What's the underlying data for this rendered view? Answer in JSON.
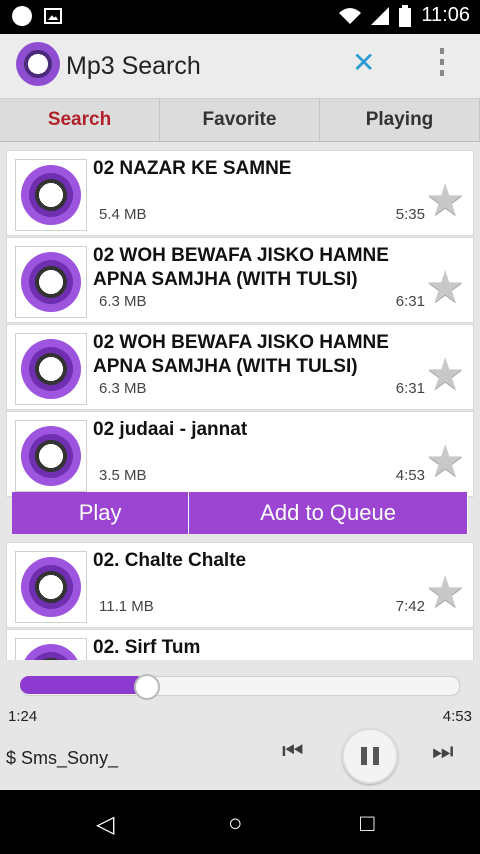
{
  "status": {
    "time": "11:06"
  },
  "appbar": {
    "title": "Mp3 Search",
    "close_symbol": "✕"
  },
  "tabs": [
    {
      "label": "Search",
      "active": true
    },
    {
      "label": "Favorite",
      "active": false
    },
    {
      "label": "Playing",
      "active": false
    }
  ],
  "songs": [
    {
      "name": "02 NAZAR KE SAMNE",
      "size": "5.4 MB",
      "duration": "5:35"
    },
    {
      "name": "02 WOH BEWAFA JISKO HAMNE APNA SAMJHA (WITH TULSI)",
      "size": "6.3 MB",
      "duration": "6:31"
    },
    {
      "name": "02 WOH BEWAFA JISKO HAMNE APNA SAMJHA (WITH TULSI)",
      "size": "6.3 MB",
      "duration": "6:31"
    },
    {
      "name": "02 judaai - jannat",
      "size": "3.5 MB",
      "duration": "4:53"
    },
    {
      "name": "02. Chalte Chalte",
      "size": "11.1 MB",
      "duration": "7:42"
    },
    {
      "name": "02. Sirf Tum",
      "size": "",
      "duration": ""
    }
  ],
  "actions": {
    "play": "Play",
    "queue": "Add to Queue"
  },
  "player": {
    "elapsed": "1:24",
    "total": "4:53",
    "artist": "Sms_Sony_",
    "artist_prefix": "$",
    "progress_fraction": 0.286
  },
  "icons": {
    "star": "★",
    "prev": "⏮",
    "next": "⏭",
    "back": "◁",
    "home": "○",
    "recent": "□"
  }
}
